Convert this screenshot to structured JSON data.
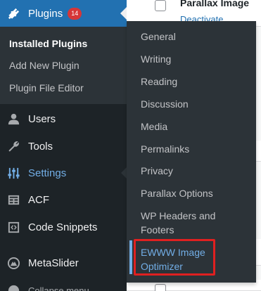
{
  "content": {
    "rows": [
      {
        "title": "Parallax Image",
        "link": "Deactivate"
      }
    ]
  },
  "menu": {
    "plugins": {
      "label": "Plugins",
      "badge": "14",
      "icon": "plugin-icon"
    },
    "plugins_submenu": [
      {
        "label": "Installed Plugins",
        "current": true
      },
      {
        "label": "Add New Plugin",
        "current": false
      },
      {
        "label": "Plugin File Editor",
        "current": false
      }
    ],
    "users": {
      "label": "Users",
      "icon": "users-icon"
    },
    "tools": {
      "label": "Tools",
      "icon": "wrench-icon"
    },
    "settings": {
      "label": "Settings",
      "icon": "sliders-icon"
    },
    "acf": {
      "label": "ACF",
      "icon": "acf-icon"
    },
    "code_snippets": {
      "label": "Code Snippets",
      "icon": "code-icon"
    },
    "metaslider": {
      "label": "MetaSlider",
      "icon": "metaslider-icon"
    },
    "collapse": {
      "label": "Collapse menu",
      "icon": "collapse-icon"
    }
  },
  "settings_flyout": [
    {
      "label": "General"
    },
    {
      "label": "Writing"
    },
    {
      "label": "Reading"
    },
    {
      "label": "Discussion"
    },
    {
      "label": "Media"
    },
    {
      "label": "Permalinks"
    },
    {
      "label": "Privacy"
    },
    {
      "label": "Parallax Options"
    },
    {
      "label": "WP Headers and Footers"
    },
    {
      "label": "EWWW Image Optimizer"
    }
  ],
  "colors": {
    "sidebar_bg": "#1d2327",
    "submenu_bg": "#2c3338",
    "accent_blue": "#2271b1",
    "hover_blue": "#72aee6",
    "badge_red": "#d63638",
    "highlight_box": "#e02020"
  }
}
